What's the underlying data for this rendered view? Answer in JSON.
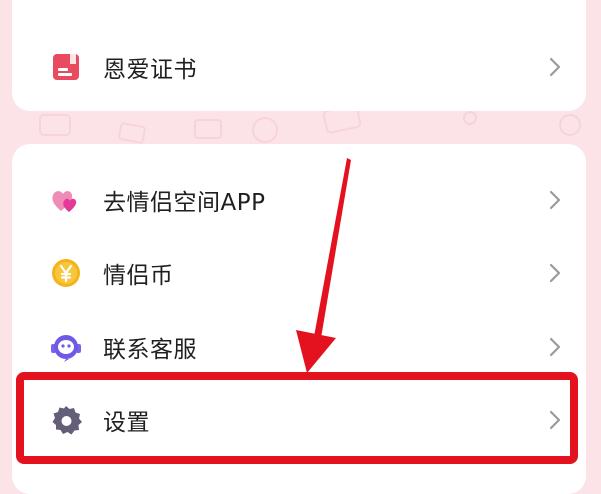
{
  "colors": {
    "background": "#fbe3e7",
    "card": "#ffffff",
    "highlight": "#e4111f",
    "chevron": "#9a9a9a"
  },
  "top_card": {
    "items": [
      {
        "label": "恩爱证书",
        "icon": "certificate-icon"
      }
    ]
  },
  "menu": {
    "items": [
      {
        "label": "去情侣空间APP",
        "icon": "hearts-icon"
      },
      {
        "label": "情侣币",
        "icon": "yen-coin-icon"
      },
      {
        "label": "联系客服",
        "icon": "customer-service-headset-icon"
      },
      {
        "label": "设置",
        "icon": "gear-icon"
      }
    ]
  },
  "annotation": {
    "highlighted_item": "设置"
  }
}
